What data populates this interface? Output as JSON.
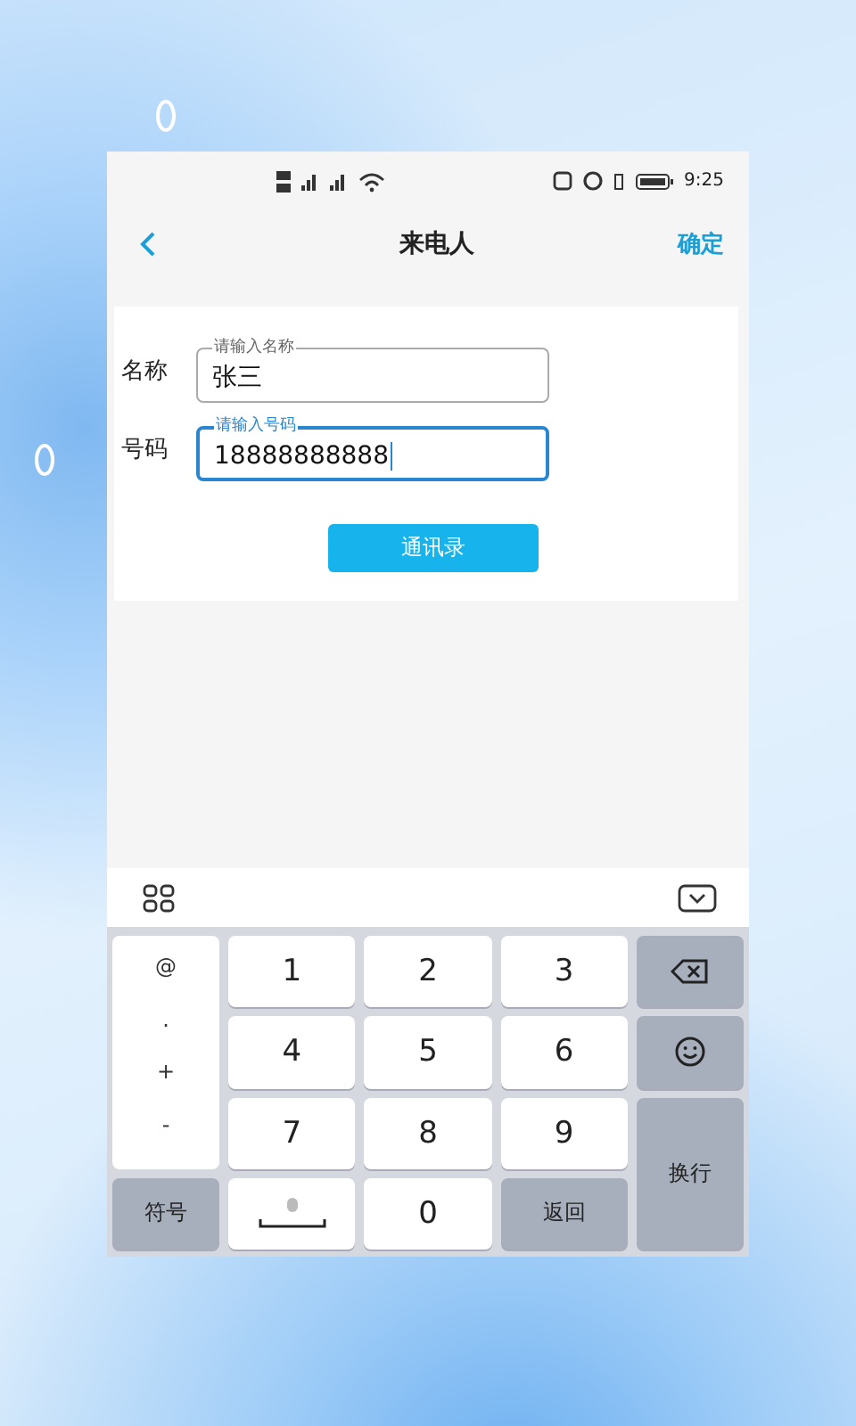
{
  "status_bar": {
    "time": "9:25"
  },
  "header": {
    "title": "来电人",
    "action": "确定"
  },
  "form": {
    "fields": [
      {
        "label": "名称",
        "legend": "请输入名称",
        "value": "张三",
        "focused": false
      },
      {
        "label": "号码",
        "legend": "请输入号码",
        "value": "18888888888",
        "focused": true
      }
    ],
    "button": "通讯录"
  },
  "keyboard": {
    "symbol_column": [
      "@",
      ".",
      "+",
      "-"
    ],
    "digits": [
      "1",
      "2",
      "3",
      "4",
      "5",
      "6",
      "7",
      "8",
      "9",
      "0"
    ],
    "symbols_key": "符号",
    "return_key": "返回",
    "enter_key": "换行"
  }
}
